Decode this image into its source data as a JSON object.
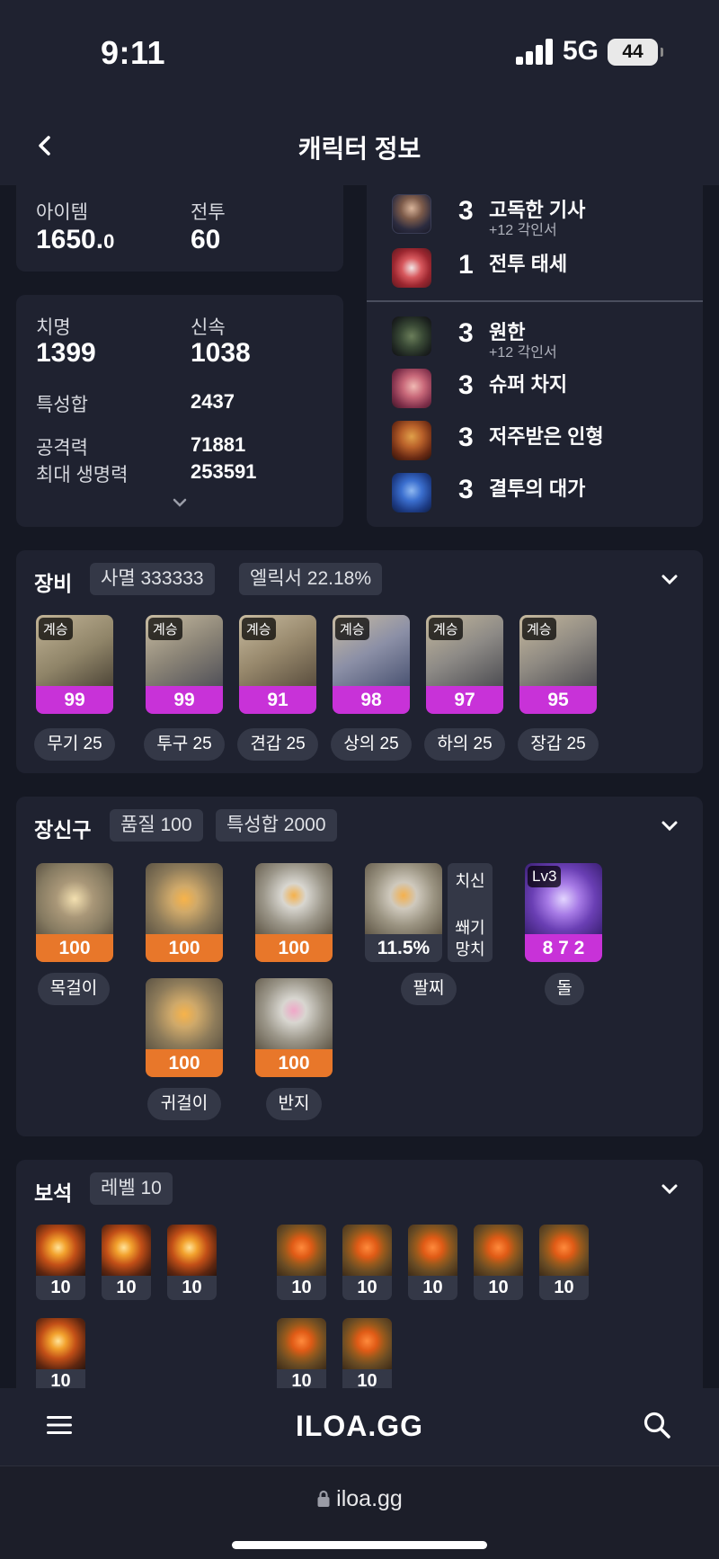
{
  "status_bar": {
    "time": "9:11",
    "network": "5G",
    "battery": "44"
  },
  "header": {
    "title": "캐릭터 정보",
    "back_icon": "chevron-left-icon"
  },
  "summary": {
    "item_label": "아이템",
    "item_value_main": "1650.",
    "item_value_frac": "0",
    "combat_label": "전투",
    "combat_value": "60"
  },
  "stats": {
    "crit_label": "치명",
    "crit_value": "1399",
    "swift_label": "신속",
    "swift_value": "1038",
    "total_label": "특성합",
    "total_value": "2437",
    "attack_label": "공격력",
    "attack_value": "71881",
    "hp_label": "최대 생명력",
    "hp_value": "253591"
  },
  "engravings": {
    "top": [
      {
        "level": "3",
        "name": "고독한 기사",
        "sub": "+12 각인서"
      },
      {
        "level": "1",
        "name": "전투 태세",
        "sub": ""
      }
    ],
    "bottom": [
      {
        "level": "3",
        "name": "원한",
        "sub": "+12 각인서"
      },
      {
        "level": "3",
        "name": "슈퍼 차지",
        "sub": ""
      },
      {
        "level": "3",
        "name": "저주받은 인형",
        "sub": ""
      },
      {
        "level": "3",
        "name": "결투의 대가",
        "sub": ""
      }
    ]
  },
  "equipment": {
    "title": "장비",
    "set_tag": "사멸 333333",
    "elixir_tag": "엘릭서 22.18%",
    "items": [
      {
        "tag": "계승",
        "quality": "99",
        "label": "무기 25"
      },
      {
        "tag": "계승",
        "quality": "99",
        "label": "투구 25"
      },
      {
        "tag": "계승",
        "quality": "91",
        "label": "견갑 25"
      },
      {
        "tag": "계승",
        "quality": "98",
        "label": "상의 25"
      },
      {
        "tag": "계승",
        "quality": "97",
        "label": "하의 25"
      },
      {
        "tag": "계승",
        "quality": "95",
        "label": "장갑 25"
      }
    ]
  },
  "accessories": {
    "title": "장신구",
    "quality_tag": "품질 100",
    "stat_tag": "특성합 2000",
    "necklace": {
      "quality": "100",
      "label": "목걸이"
    },
    "earrings": [
      {
        "quality": "100"
      },
      {
        "quality": "100"
      }
    ],
    "earring_label": "귀걸이",
    "rings": [
      {
        "quality": "100"
      },
      {
        "quality": "100"
      }
    ],
    "ring_label": "반지",
    "bracelet": {
      "value": "11.5%",
      "label": "팔찌",
      "effect1": "치신",
      "effect2": "쐐기",
      "effect3": "망치"
    },
    "stone": {
      "level": "Lv3",
      "value": "8 7 2",
      "label": "돌"
    }
  },
  "gems": {
    "title": "보석",
    "level_tag": "레벨 10",
    "left": [
      "10",
      "10",
      "10",
      "10"
    ],
    "right": [
      "10",
      "10",
      "10",
      "10",
      "10",
      "10",
      "10"
    ]
  },
  "bottom_nav": {
    "menu_icon": "hamburger-menu-icon",
    "logo": "ILOA.GG",
    "search_icon": "search-icon"
  },
  "browser": {
    "url": "iloa.gg",
    "lock_icon": "lock-icon"
  }
}
